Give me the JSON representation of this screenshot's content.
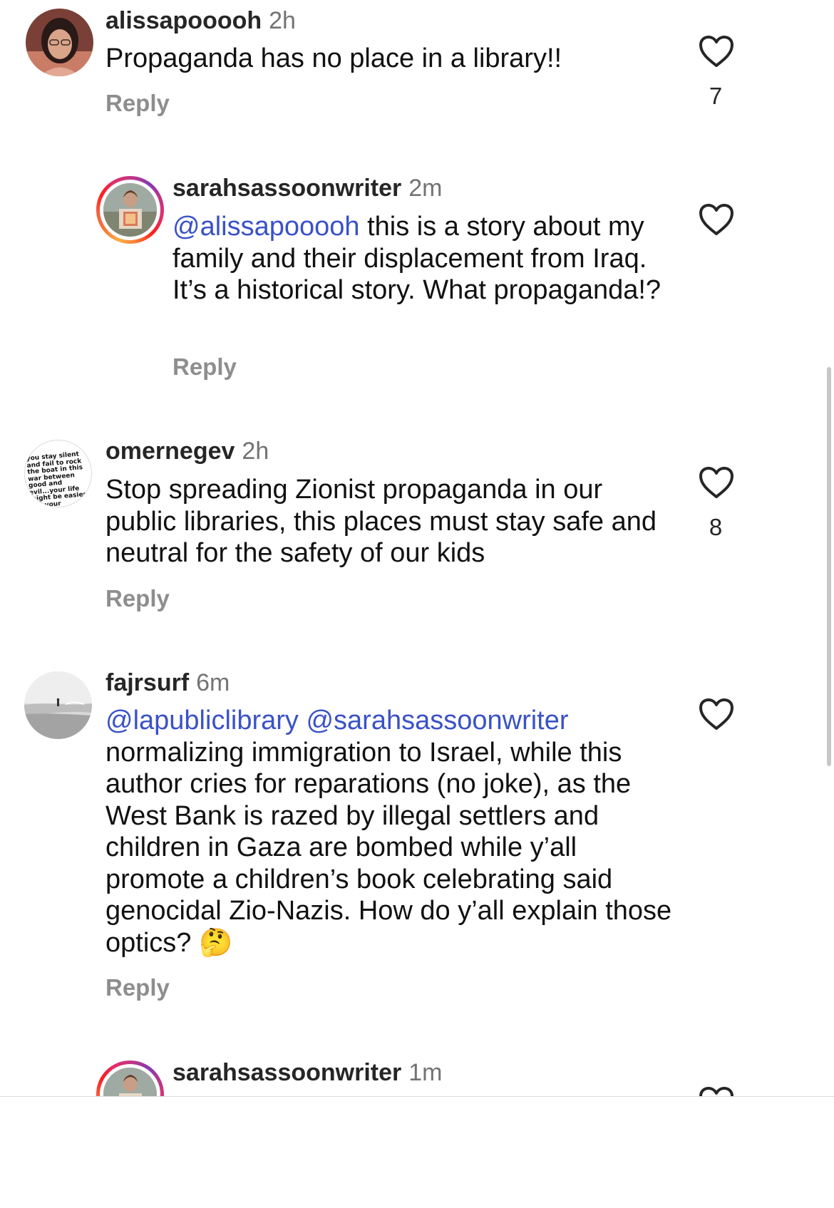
{
  "comments": [
    {
      "username": "alissapooooh",
      "time": "2h",
      "text_mention": "",
      "text": "Propaganda has no place in a library!!",
      "reply_label": "Reply",
      "likes": "7",
      "avatar": "profile-photo"
    },
    {
      "username": "sarahsassoonwriter",
      "time": "2m",
      "text_mention": "@alissapooooh",
      "text": " this is a story about my family and their displacement from Iraq. It’s a historical story. What propaganda!?",
      "reply_label": "Reply",
      "likes": "",
      "avatar": "profile-photo-story-ring"
    },
    {
      "username": "omernegev",
      "time": "2h",
      "text_mention": "",
      "text": "Stop spreading Zionist propaganda in our public libraries, this places must stay safe and neutral for the safety of our kids",
      "reply_label": "Reply",
      "likes": "8",
      "avatar": "quote-image",
      "avatar_text": "you stay silent and fail to rock the boat in this war between good and evil...your life might be easier but your children's won't"
    },
    {
      "username": "fajrsurf",
      "time": "6m",
      "text_mention": "@lapubliclibrary @sarahsassoonwriter",
      "text": " normalizing immigration to Israel, while this author cries for reparations (no joke), as the West Bank is razed by illegal settlers and children in Gaza are bombed while y’all promote a children’s book celebrating said genocidal Zio-Nazis. How do y’all explain those optics? 🤔",
      "reply_label": "Reply",
      "likes": "",
      "avatar": "beach-photo"
    },
    {
      "username": "sarahsassoonwriter",
      "time": "1m",
      "text_mention": "",
      "text": "",
      "reply_label": "",
      "likes": "",
      "avatar": "profile-photo-story-ring"
    }
  ],
  "icons": {
    "like": "heart-outline-icon",
    "thinking": "thinking-face-emoji"
  },
  "colors": {
    "mention": "#3a52c7",
    "secondary_text": "#737373",
    "reply_text": "#8e8e8e"
  }
}
